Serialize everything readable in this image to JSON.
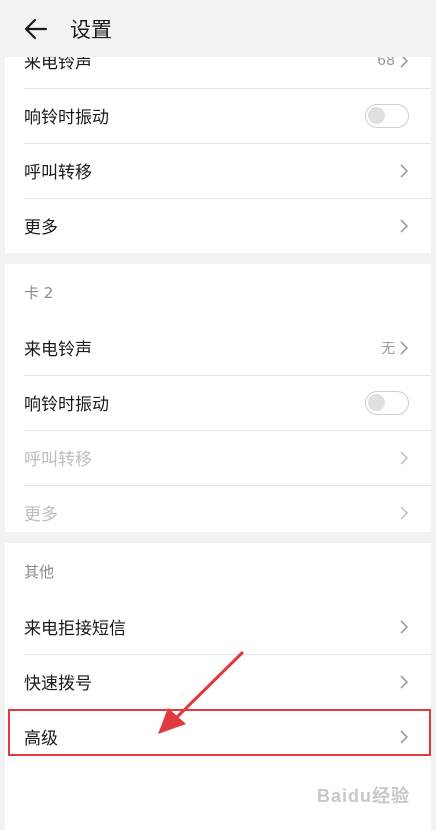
{
  "appbar": {
    "title": "设置",
    "back_icon": "arrow-left-icon"
  },
  "card1": {
    "rows": [
      {
        "label": "来电铃声",
        "value": "68"
      },
      {
        "label": "响铃时振动",
        "toggle": false
      },
      {
        "label": "呼叫转移"
      },
      {
        "label": "更多"
      }
    ]
  },
  "card2": {
    "section_title": "卡 2",
    "rows": [
      {
        "label": "来电铃声",
        "value": "无"
      },
      {
        "label": "响铃时振动",
        "toggle": false
      },
      {
        "label": "呼叫转移",
        "disabled": true
      },
      {
        "label": "更多",
        "disabled": true
      }
    ]
  },
  "card3": {
    "section_title": "其他",
    "rows": [
      {
        "label": "来电拒接短信"
      },
      {
        "label": "快速拨号"
      },
      {
        "label": "高级"
      }
    ]
  },
  "annotation": {
    "highlight_color": "#e0393e"
  },
  "watermark": {
    "text": "Baidu经验"
  }
}
